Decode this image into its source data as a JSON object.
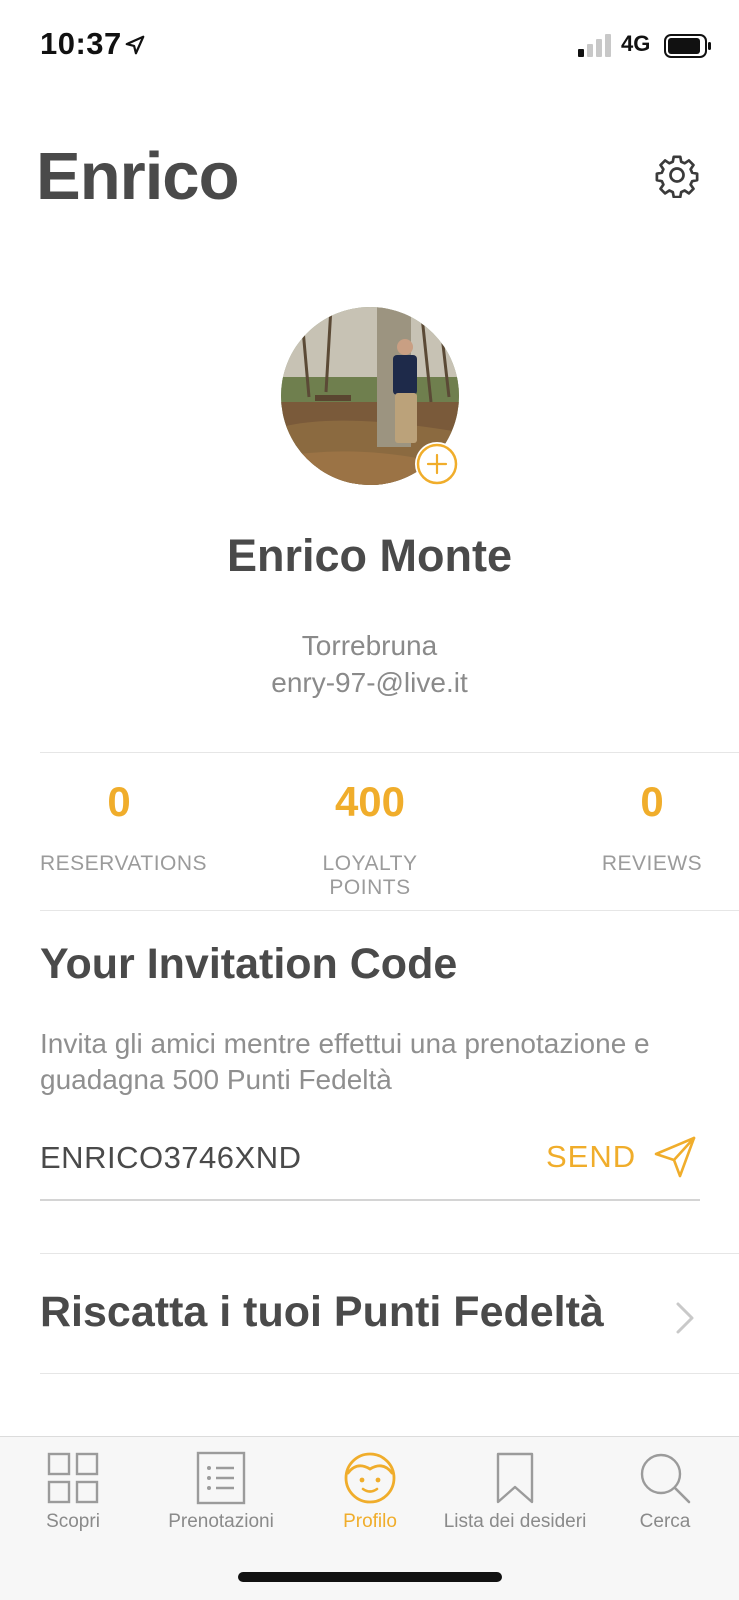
{
  "status_bar": {
    "time": "10:37",
    "network": "4G"
  },
  "header": {
    "title": "Enrico"
  },
  "profile": {
    "name": "Enrico Monte",
    "city": "Torrebruna",
    "email": "enry-97-@live.it"
  },
  "stats": [
    {
      "value": "0",
      "label": "RESERVATIONS"
    },
    {
      "value": "400",
      "label": "LOYALTY POINTS"
    },
    {
      "value": "0",
      "label": "REVIEWS"
    }
  ],
  "invitation": {
    "title": "Your Invitation Code",
    "description": "Invita gli amici mentre effettui una prenotazione e guadagna 500 Punti Fedeltà",
    "code": "ENRICO3746XND",
    "send_label": "SEND"
  },
  "redeem": {
    "label": "Riscatta i tuoi Punti Fedeltà"
  },
  "tabs": [
    {
      "label": "Scopri",
      "icon": "grid-icon",
      "active": false
    },
    {
      "label": "Prenotazioni",
      "icon": "list-icon",
      "active": false
    },
    {
      "label": "Profilo",
      "icon": "face-icon",
      "active": true
    },
    {
      "label": "Lista dei desideri",
      "icon": "bookmark-icon",
      "active": false
    },
    {
      "label": "Cerca",
      "icon": "search-icon",
      "active": false
    }
  ],
  "colors": {
    "accent": "#f0ad2b",
    "text": "#4a4a4a",
    "muted": "#8f8f8f"
  }
}
